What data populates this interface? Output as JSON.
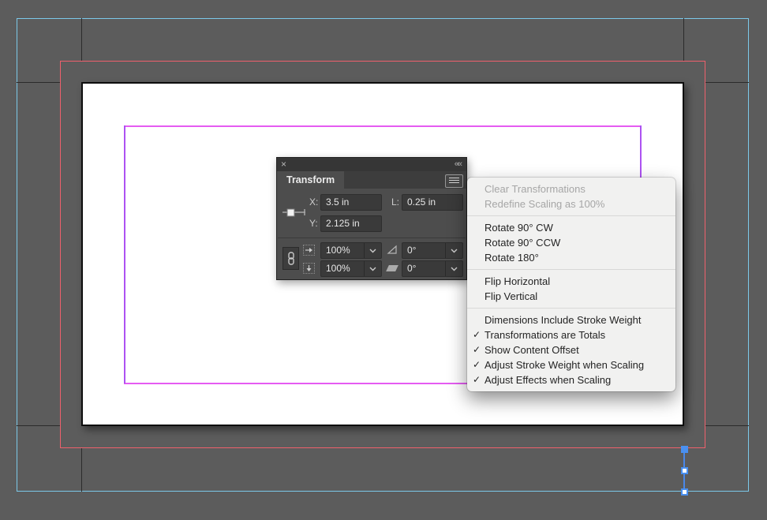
{
  "document": {
    "selected_object": {
      "type": "vertical-line",
      "x_value": "3.5 in",
      "y_value": "2.125 in",
      "length_value": "0.25 in"
    },
    "guide_colors": {
      "slug": "#7cc9e9",
      "bleed": "#ef606c",
      "margin": "#e55cf2",
      "column": "#ad52f2",
      "selection": "#4a87e8"
    }
  },
  "panel": {
    "tab_label": "Transform",
    "close_glyph": "×",
    "collapse_glyph": "««",
    "x_label": "X:",
    "x_value": "3.5 in",
    "y_label": "Y:",
    "y_value": "2.125 in",
    "l_label": "L:",
    "l_value": "0.25 in",
    "scale_x_value": "100%",
    "scale_y_value": "100%",
    "rotation_value": "0°",
    "shear_value": "0°"
  },
  "menu": {
    "check_glyph": "✓",
    "sections": [
      {
        "items": [
          {
            "label": "Clear Transformations",
            "disabled": true
          },
          {
            "label": "Redefine Scaling as 100%",
            "disabled": true
          }
        ]
      },
      {
        "items": [
          {
            "label": "Rotate 90° CW"
          },
          {
            "label": "Rotate 90° CCW"
          },
          {
            "label": "Rotate 180°"
          }
        ]
      },
      {
        "items": [
          {
            "label": "Flip Horizontal"
          },
          {
            "label": "Flip Vertical"
          }
        ]
      },
      {
        "items": [
          {
            "label": "Dimensions Include Stroke Weight"
          },
          {
            "label": "Transformations are Totals",
            "checked": true
          },
          {
            "label": "Show Content Offset",
            "checked": true
          },
          {
            "label": "Adjust Stroke Weight when Scaling",
            "checked": true
          },
          {
            "label": "Adjust Effects when Scaling",
            "checked": true
          }
        ]
      }
    ]
  }
}
